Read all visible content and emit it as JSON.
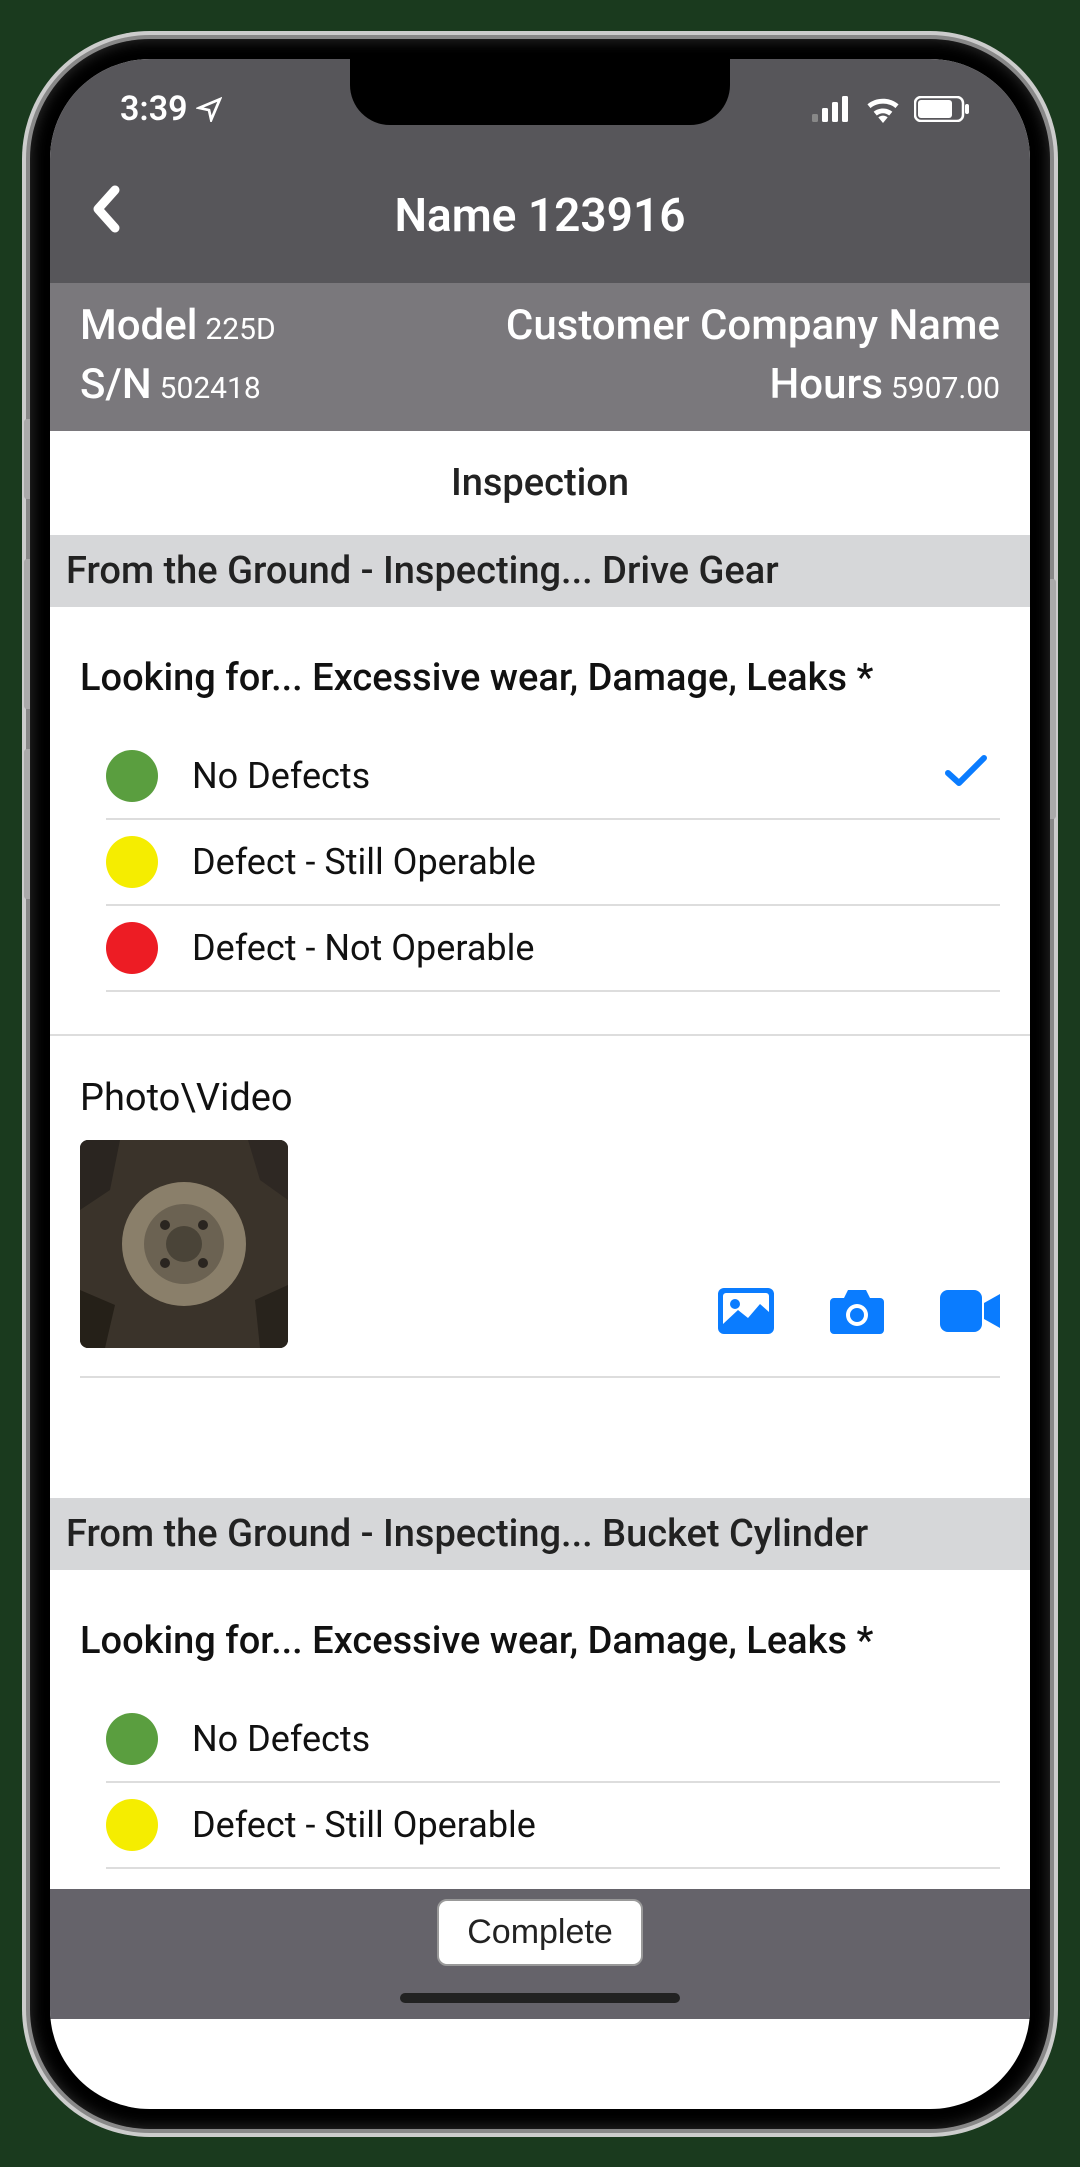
{
  "status": {
    "time": "3:39"
  },
  "header": {
    "title": "Name 123916"
  },
  "subheader": {
    "model_label": "Model",
    "model_value": "225D",
    "sn_label": "S/N",
    "sn_value": "502418",
    "customer": "Customer Company Name",
    "hours_label": "Hours",
    "hours_value": "5907.00"
  },
  "tab": "Inspection",
  "colors": {
    "green": "#5a9e3f",
    "yellow": "#f5ed00",
    "red": "#ed1c24",
    "accent": "#0a7cff"
  },
  "sections": [
    {
      "title": "From the Ground - Inspecting... Drive Gear",
      "question": "Looking for... Excessive wear, Damage, Leaks *",
      "options": [
        {
          "label": "No Defects",
          "color": "green",
          "selected": true
        },
        {
          "label": "Defect - Still Operable",
          "color": "yellow",
          "selected": false
        },
        {
          "label": "Defect - Not Operable",
          "color": "red",
          "selected": false
        }
      ],
      "photo_label": "Photo\\Video",
      "has_photo": true
    },
    {
      "title": "From the Ground - Inspecting... Bucket Cylinder",
      "question": "Looking for... Excessive wear, Damage, Leaks *",
      "options": [
        {
          "label": "No Defects",
          "color": "green",
          "selected": false
        },
        {
          "label": "Defect - Still Operable",
          "color": "yellow",
          "selected": false
        }
      ]
    }
  ],
  "footer": {
    "complete": "Complete"
  }
}
